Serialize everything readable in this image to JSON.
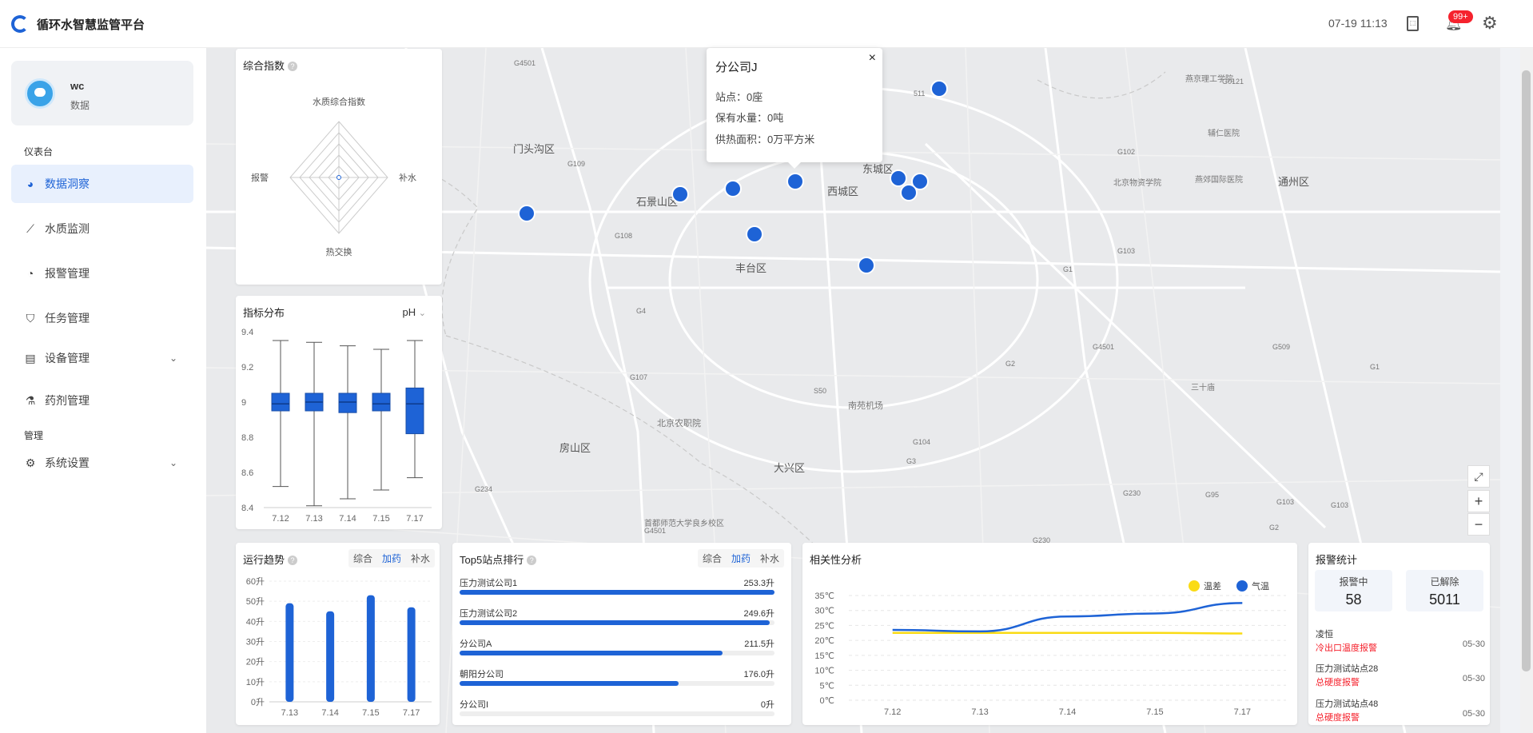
{
  "header": {
    "title": "循环水智慧监管平台",
    "time": "07-19 11:13",
    "badge": "99+"
  },
  "user": {
    "name": "wc",
    "role": "数据"
  },
  "nav": {
    "group1": "仪表台",
    "items": [
      {
        "label": "数据洞察",
        "icon": "dashboard-icon"
      },
      {
        "label": "水质监测",
        "icon": "line-chart-icon"
      },
      {
        "label": "报警管理",
        "icon": "pie-chart-icon"
      },
      {
        "label": "任务管理",
        "icon": "tag-icon"
      },
      {
        "label": "设备管理",
        "icon": "device-icon"
      },
      {
        "label": "药剂管理",
        "icon": "flask-icon"
      }
    ],
    "group2": "管理",
    "settings": "系统设置"
  },
  "map": {
    "labels": [
      "门头沟区",
      "石景山区",
      "西城区",
      "东城区",
      "丰台区",
      "房山区",
      "大兴区",
      "通州区",
      "北京农职院",
      "南苑机场",
      "首都师范大学良乡校区",
      "北京物资学院",
      "燕京理工学院",
      "燕郊国际医院",
      "辅仁医院",
      "三十庙",
      "G4501",
      "G109",
      "G108",
      "G4",
      "G107",
      "S50",
      "G104",
      "G3",
      "G1",
      "G2",
      "G103",
      "G102",
      "G0121",
      "G4501",
      "G230",
      "G95",
      "G103",
      "G2",
      "G234",
      "G4501",
      "G230",
      "G103",
      "G509",
      "G1",
      "511"
    ],
    "popup": {
      "title": "分公司J",
      "rows": [
        "站点：0座",
        "保有水量：0吨",
        "供热面积：0万平方米"
      ],
      "close": "×"
    },
    "zoom_in": "+",
    "zoom_out": "−",
    "fullscreen": "⤢"
  },
  "composite": {
    "title": "综合指数",
    "chart_data": {
      "type": "radar",
      "title": "水质综合指数",
      "axes": [
        "水质综合指数",
        "补水",
        "热交换",
        "报警"
      ],
      "values": [
        0,
        0,
        0,
        0
      ]
    }
  },
  "distribution": {
    "title": "指标分布",
    "select": "pH",
    "chart_data": {
      "type": "boxplot",
      "categories": [
        "7.12",
        "7.13",
        "7.14",
        "7.15",
        "7.17"
      ],
      "yticks": [
        "9.4",
        "9.2",
        "9",
        "8.8",
        "8.6",
        "8.4"
      ],
      "ylim": [
        8.4,
        9.4
      ],
      "boxes": [
        {
          "min": 8.52,
          "q1": 8.95,
          "median": 8.99,
          "q3": 9.05,
          "max": 9.35
        },
        {
          "min": 8.41,
          "q1": 8.95,
          "median": 9.0,
          "q3": 9.05,
          "max": 9.34
        },
        {
          "min": 8.45,
          "q1": 8.94,
          "median": 9.0,
          "q3": 9.05,
          "max": 9.32
        },
        {
          "min": 8.5,
          "q1": 8.95,
          "median": 8.99,
          "q3": 9.05,
          "max": 9.3
        },
        {
          "min": 8.57,
          "q1": 8.82,
          "median": 8.99,
          "q3": 9.08,
          "max": 9.35
        }
      ]
    }
  },
  "trend": {
    "title": "运行趋势",
    "tabs": [
      "综合",
      "加药",
      "补水"
    ],
    "active": 1,
    "chart_data": {
      "type": "bar",
      "categories": [
        "7.13",
        "7.14",
        "7.15",
        "7.17"
      ],
      "values": [
        49,
        45,
        53,
        47
      ],
      "yticks": [
        "60升",
        "50升",
        "40升",
        "30升",
        "20升",
        "10升",
        "0升"
      ],
      "ylim": [
        0,
        60
      ]
    }
  },
  "top5": {
    "title": "Top5站点排行",
    "tabs": [
      "综合",
      "加药",
      "补水"
    ],
    "active": 1,
    "rows": [
      {
        "name": "压力测试公司1",
        "value": "253.3升",
        "pct": 100
      },
      {
        "name": "压力测试公司2",
        "value": "249.6升",
        "pct": 98.5
      },
      {
        "name": "分公司A",
        "value": "211.5升",
        "pct": 83.5
      },
      {
        "name": "朝阳分公司",
        "value": "176.0升",
        "pct": 69.5
      },
      {
        "name": "分公司I",
        "value": "0升",
        "pct": 0
      }
    ]
  },
  "correlation": {
    "title": "相关性分析",
    "chart_data": {
      "type": "line",
      "x": [
        "7.12",
        "7.13",
        "7.14",
        "7.15",
        "7.17"
      ],
      "yticks": [
        "35℃",
        "30℃",
        "25℃",
        "20℃",
        "15℃",
        "10℃",
        "5℃",
        "0℃"
      ],
      "ylim": [
        0,
        35
      ],
      "series": [
        {
          "name": "温差",
          "color": "#fadb14",
          "values": [
            22.5,
            22.5,
            22.5,
            22.5,
            22.3
          ]
        },
        {
          "name": "气温",
          "color": "#1e63d6",
          "values": [
            23.5,
            23,
            28,
            29,
            32.5
          ]
        }
      ]
    }
  },
  "alarm": {
    "title": "报警统计",
    "pending_label": "报警中",
    "pending": "58",
    "resolved_label": "已解除",
    "resolved": "5011",
    "items": [
      {
        "name": "凌恒",
        "type": "冷出口温度报警",
        "date": "05-30"
      },
      {
        "name": "压力测试站点28",
        "type": "总硬度报警",
        "date": "05-30"
      },
      {
        "name": "压力测试站点48",
        "type": "总硬度报警",
        "date": "05-30"
      }
    ]
  }
}
